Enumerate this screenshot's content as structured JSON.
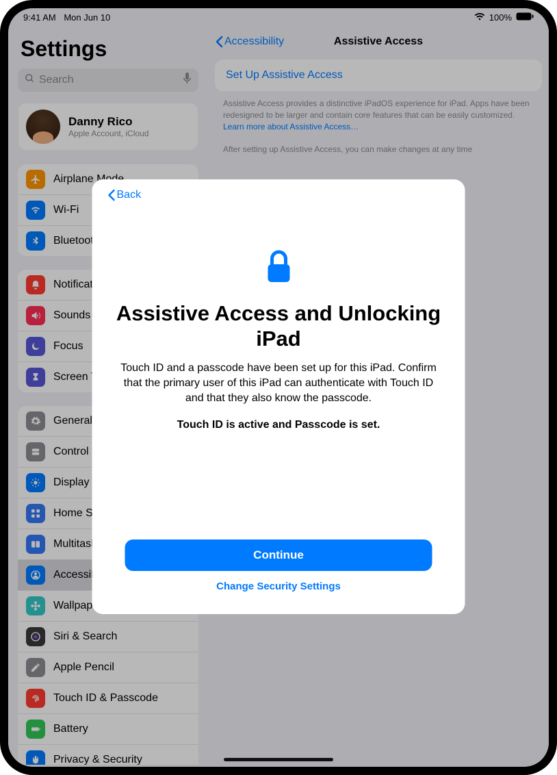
{
  "status": {
    "time": "9:41 AM",
    "date": "Mon Jun 10",
    "battery": "100%"
  },
  "sidebar": {
    "title": "Settings",
    "search_placeholder": "Search",
    "profile": {
      "name": "Danny Rico",
      "sub": "Apple Account, iCloud"
    },
    "g1": [
      {
        "label": "Airplane Mode",
        "color": "#ff9500",
        "icon": "airplane"
      },
      {
        "label": "Wi-Fi",
        "color": "#007aff",
        "icon": "wifi"
      },
      {
        "label": "Bluetooth",
        "color": "#007aff",
        "icon": "bluetooth"
      }
    ],
    "g2": [
      {
        "label": "Notifications",
        "color": "#ff3b30",
        "icon": "bell"
      },
      {
        "label": "Sounds",
        "color": "#ff2d55",
        "icon": "speaker"
      },
      {
        "label": "Focus",
        "color": "#5856d6",
        "icon": "moon"
      },
      {
        "label": "Screen Time",
        "color": "#5856d6",
        "icon": "hourglass"
      }
    ],
    "g3": [
      {
        "label": "General",
        "color": "#8e8e93",
        "icon": "gear"
      },
      {
        "label": "Control Center",
        "color": "#8e8e93",
        "icon": "switches"
      },
      {
        "label": "Display & Brightness",
        "color": "#007aff",
        "icon": "sun"
      },
      {
        "label": "Home Screen & App Library",
        "color": "#3478f6",
        "icon": "grid"
      },
      {
        "label": "Multitasking & Gestures",
        "color": "#3478f6",
        "icon": "multi"
      },
      {
        "label": "Accessibility",
        "color": "#007aff",
        "icon": "person"
      },
      {
        "label": "Wallpaper",
        "color": "#34c8c8",
        "icon": "flower"
      },
      {
        "label": "Siri & Search",
        "color": "#3a3a3c",
        "icon": "siri"
      },
      {
        "label": "Apple Pencil",
        "color": "#8e8e93",
        "icon": "pencil"
      },
      {
        "label": "Touch ID & Passcode",
        "color": "#ff3b30",
        "icon": "finger"
      },
      {
        "label": "Battery",
        "color": "#34c759",
        "icon": "battery"
      },
      {
        "label": "Privacy & Security",
        "color": "#007aff",
        "icon": "hand"
      }
    ]
  },
  "detail": {
    "back": "Accessibility",
    "title": "Assistive Access",
    "setup": "Set Up Assistive Access",
    "desc": "Assistive Access provides a distinctive iPadOS experience for iPad. Apps have been redesigned to be larger and contain core features that can be easily customized.",
    "link": "Learn more about Assistive Access…",
    "desc2": "After setting up Assistive Access, you can make changes at any time"
  },
  "sheet": {
    "back": "Back",
    "title": "Assistive Access and Unlocking iPad",
    "body": "Touch ID and a passcode have been set up for this iPad. Confirm that the primary user of this iPad can authenticate with Touch ID and that they also know the passcode.",
    "bold": "Touch ID is active and Passcode is set.",
    "continue": "Continue",
    "change": "Change Security Settings"
  }
}
